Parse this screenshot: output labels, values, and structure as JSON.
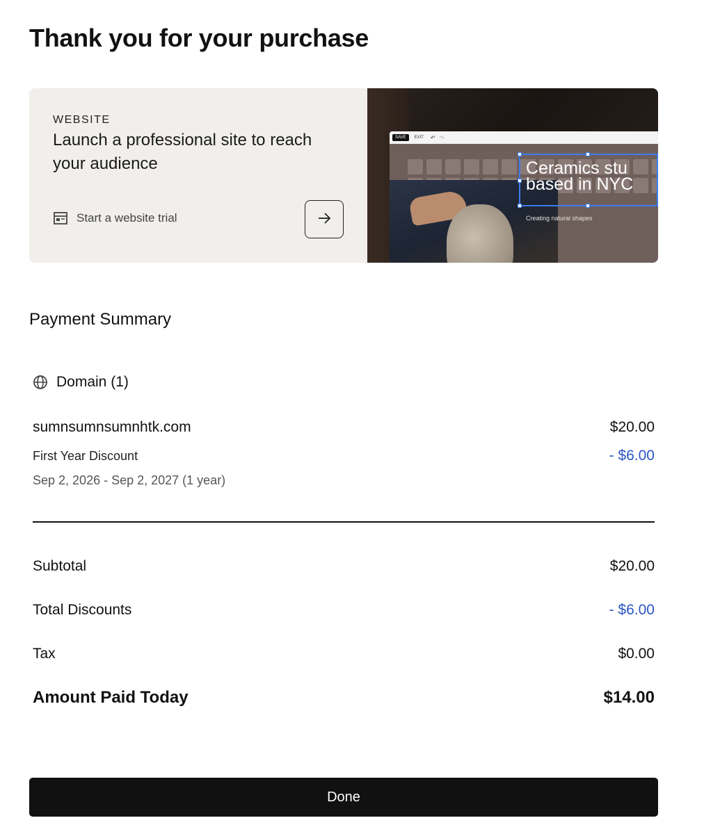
{
  "page": {
    "title": "Thank you for your purchase"
  },
  "promo": {
    "eyebrow": "WEBSITE",
    "heading": "Launch a professional site to reach your audience",
    "link_label": "Start a website trial",
    "link_icon": "website-layout-icon",
    "arrow_icon": "arrow-right-icon",
    "image": {
      "save_label": "SAVE",
      "exit_label": "EXIT",
      "headline_line1": "Ceramics stu",
      "headline_line2": "based in NYC",
      "caption": "Creating natural shapes"
    }
  },
  "summary": {
    "title": "Payment Summary",
    "category": {
      "icon": "globe-icon",
      "label": "Domain (1)"
    },
    "item": {
      "name": "sumnsumnsumnhtk.com",
      "price": "$20.00",
      "discount_label": "First Year Discount",
      "discount_value": "- $6.00",
      "period": "Sep 2, 2026 - Sep 2, 2027 (1 year)"
    },
    "subtotal": {
      "label": "Subtotal",
      "value": "$20.00"
    },
    "discounts": {
      "label": "Total Discounts",
      "value": "- $6.00"
    },
    "tax": {
      "label": "Tax",
      "value": "$0.00"
    },
    "total": {
      "label": "Amount Paid Today",
      "value": "$14.00"
    }
  },
  "actions": {
    "done_label": "Done"
  },
  "colors": {
    "accent_blue": "#2b56c6",
    "button_bg": "#111111",
    "promo_bg": "#f1efeb"
  }
}
